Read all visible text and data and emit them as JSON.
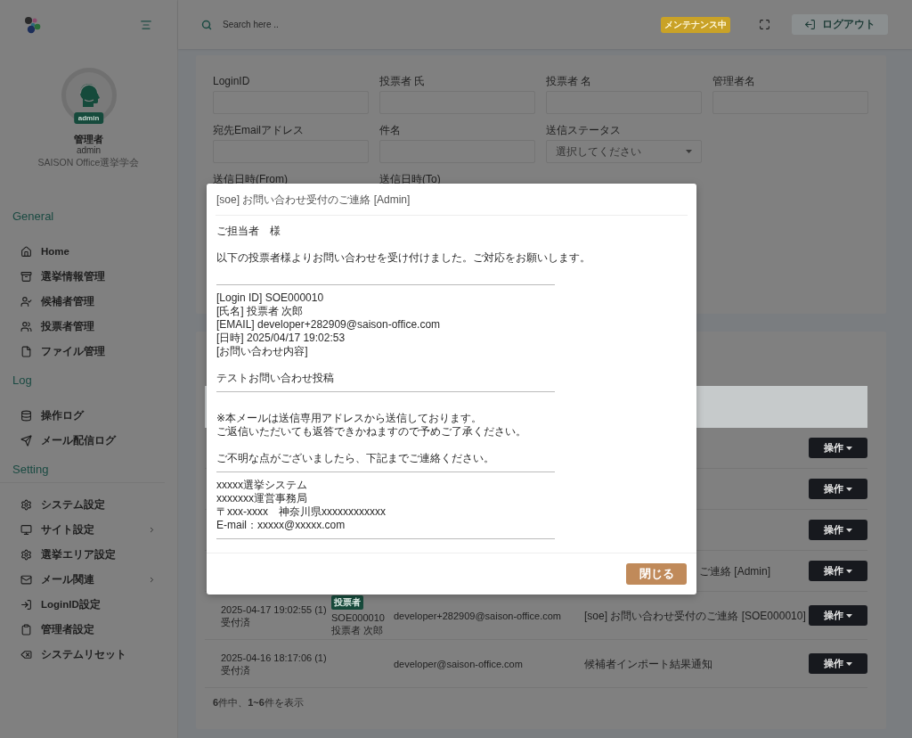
{
  "sidebar": {
    "profile": {
      "role_badge": "admin",
      "name": "管理者",
      "username": "admin",
      "organization": "SAISON Office選挙学会"
    },
    "sections": [
      {
        "title": "General",
        "divided": false,
        "items": [
          {
            "label": "Home",
            "expandable": false
          },
          {
            "label": "選挙情報管理",
            "expandable": false
          },
          {
            "label": "候補者管理",
            "expandable": false
          },
          {
            "label": "投票者管理",
            "expandable": false
          },
          {
            "label": "ファイル管理",
            "expandable": false
          }
        ]
      },
      {
        "title": "Log",
        "divided": false,
        "items": [
          {
            "label": "操作ログ",
            "expandable": false
          },
          {
            "label": "メール配信ログ",
            "expandable": false
          }
        ]
      },
      {
        "title": "Setting",
        "divided": true,
        "items": [
          {
            "label": "システム設定",
            "expandable": false
          },
          {
            "label": "サイト設定",
            "expandable": true
          },
          {
            "label": "選挙エリア設定",
            "expandable": false
          },
          {
            "label": "メール関連",
            "expandable": true
          },
          {
            "label": "LoginID設定",
            "expandable": false
          },
          {
            "label": "管理者設定",
            "expandable": false
          },
          {
            "label": "システムリセット",
            "expandable": false
          }
        ]
      }
    ]
  },
  "topbar": {
    "search": {
      "placeholder": "Search here .."
    },
    "status_badge": "メンテナンス中",
    "logout_button": "ログアウト"
  },
  "filters": [
    [
      {
        "label": "LoginID",
        "kind": "text"
      },
      {
        "label": "投票者 氏",
        "kind": "text"
      },
      {
        "label": "投票者 名",
        "kind": "text"
      },
      {
        "label": "管理者名",
        "kind": "text"
      }
    ],
    [
      {
        "label": "宛先Emailアドレス",
        "kind": "text"
      },
      {
        "label": "件名",
        "kind": "text"
      },
      {
        "label": "送信ステータス",
        "kind": "select",
        "placeholder": "選択してください"
      }
    ],
    [
      {
        "label": "送信日時(From)",
        "kind": "text"
      },
      {
        "label": "送信日時(To)",
        "kind": "text"
      }
    ]
  ],
  "mail_log": {
    "rows": [
      {
        "kind": "covered",
        "action": "操作"
      },
      {
        "kind": "covered",
        "action": "操作"
      },
      {
        "kind": "covered",
        "action": "操作"
      },
      {
        "kind": "covered",
        "subject": "ご連絡 [Admin]",
        "action": "操作"
      },
      {
        "kind": "full",
        "sent_at": "2025-04-17 19:02:55 (1)",
        "status": "受付済",
        "role_badge": "投票者",
        "login_id": "SOE000010",
        "name": "投票者 次郎",
        "email": "developer+282909@saison-office.com",
        "subject": "[soe] お問い合わせ受付のご連絡 [SOE000010]",
        "action": "操作"
      },
      {
        "kind": "full",
        "sent_at": "2025-04-16 18:17:06 (1)",
        "status": "受付済",
        "email": "developer@saison-office.com",
        "subject": "候補者インポート結果通知",
        "action": "操作"
      }
    ],
    "summary": "**6**件中、**1~6**件を表示"
  },
  "modal": {
    "title": "[soe] お問い合わせ受付のご連絡 [Admin]",
    "lines": [
      {
        "kind": "text",
        "text": "ご担当者　様"
      },
      {
        "kind": "gap"
      },
      {
        "kind": "text",
        "text": "以下の投票者様よりお問い合わせを受け付けました。ご対応をお願いします。"
      },
      {
        "kind": "gap"
      },
      {
        "kind": "rule"
      },
      {
        "kind": "text",
        "text": "[Login ID] SOE000010"
      },
      {
        "kind": "text",
        "text": "[氏名] 投票者 次郎"
      },
      {
        "kind": "text",
        "text": "[EMAIL] developer+282909@saison-office.com"
      },
      {
        "kind": "text",
        "text": "[日時] 2025/04/17 19:02:53"
      },
      {
        "kind": "text",
        "text": "[お問い合わせ内容]"
      },
      {
        "kind": "gap"
      },
      {
        "kind": "text",
        "text": "テストお問い合わせ投稿"
      },
      {
        "kind": "rule"
      },
      {
        "kind": "gap"
      },
      {
        "kind": "text",
        "text": "※本メールは送信専用アドレスから送信しております。"
      },
      {
        "kind": "text",
        "text": "ご返信いただいても返答できかねますので予めご了承ください。"
      },
      {
        "kind": "gap"
      },
      {
        "kind": "text",
        "text": "ご不明な点がございましたら、下記までご連絡ください。"
      },
      {
        "kind": "rule"
      },
      {
        "kind": "text",
        "text": "xxxxx選挙システム"
      },
      {
        "kind": "text",
        "text": "xxxxxxx運営事務局"
      },
      {
        "kind": "text",
        "text": "〒xxx-xxxx　神奈川県xxxxxxxxxxxx"
      },
      {
        "kind": "text",
        "text": "E-mail：xxxxx@xxxxx.com"
      },
      {
        "kind": "rule"
      }
    ],
    "close_button": "閉じる"
  }
}
